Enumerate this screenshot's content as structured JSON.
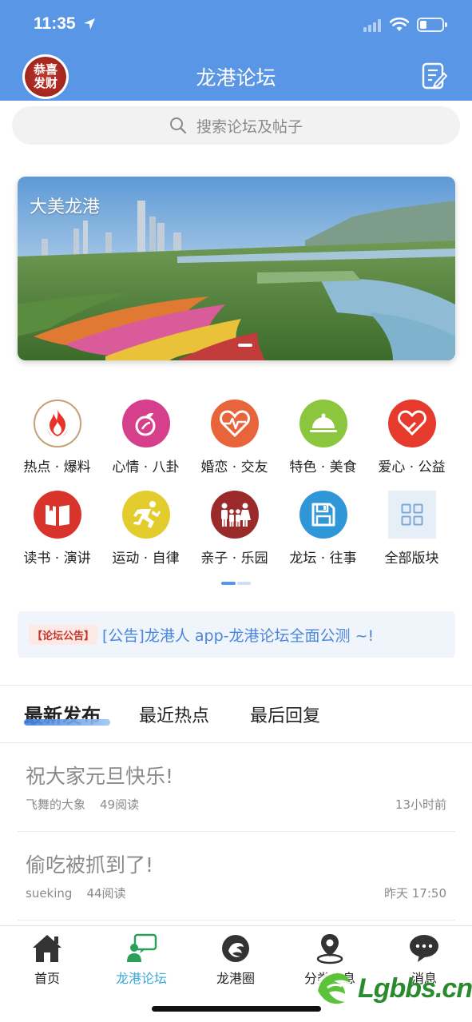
{
  "status_bar": {
    "time": "11:35"
  },
  "header": {
    "avatar_text_line1": "恭喜",
    "avatar_text_line2": "发财",
    "title": "龙港论坛"
  },
  "search": {
    "placeholder": "搜索论坛及帖子"
  },
  "banner": {
    "caption": "大美龙港"
  },
  "categories": [
    {
      "label": "热点 · 爆料",
      "icon": "flame-icon",
      "color": "#ffffff"
    },
    {
      "label": "心情 · 八卦",
      "icon": "fruit-icon",
      "color": "#d63f8c"
    },
    {
      "label": "婚恋 · 交友",
      "icon": "heartbeat-icon",
      "color": "#e8643a"
    },
    {
      "label": "特色 · 美食",
      "icon": "dish-cover-icon",
      "color": "#8cc63f"
    },
    {
      "label": "爱心 · 公益",
      "icon": "hand-heart-icon",
      "color": "#e53a2c"
    },
    {
      "label": "读书 · 演讲",
      "icon": "book-icon",
      "color": "#d9342b"
    },
    {
      "label": "运动 · 自律",
      "icon": "runner-icon",
      "color": "#e3cd2e"
    },
    {
      "label": "亲子 · 乐园",
      "icon": "family-icon",
      "color": "#9b2b2b"
    },
    {
      "label": "龙坛 · 往事",
      "icon": "save-disk-icon",
      "color": "#2f97d8"
    },
    {
      "label": "全部版块",
      "icon": "grid-icon",
      "color": "#e6eef7"
    }
  ],
  "notice": {
    "tag": "【论坛公告】",
    "text": "[公告]龙港人 app-龙港论坛全面公测 ~!"
  },
  "tabs": [
    {
      "label": "最新发布",
      "active": true
    },
    {
      "label": "最近热点",
      "active": false
    },
    {
      "label": "最后回复",
      "active": false
    }
  ],
  "posts": [
    {
      "title": "祝大家元旦快乐!",
      "author": "飞舞的大象",
      "reads": "49阅读",
      "time": "13小时前"
    },
    {
      "title": "偷吃被抓到了!",
      "author": "sueking",
      "reads": "44阅读",
      "time": "昨天 17:50"
    }
  ],
  "bottom_nav": [
    {
      "label": "首页",
      "icon": "home-icon",
      "active": false
    },
    {
      "label": "龙港论坛",
      "icon": "forum-chat-icon",
      "active": true
    },
    {
      "label": "龙港圈",
      "icon": "dragon-circle-icon",
      "active": false
    },
    {
      "label": "分类信息",
      "icon": "location-pin-icon",
      "active": false
    },
    {
      "label": "消息",
      "icon": "message-bubble-icon",
      "active": false
    }
  ],
  "watermark": {
    "text": "Lgbbs.cn"
  },
  "colors": {
    "primary": "#5a96e6",
    "active_nav": "#3aa8d8",
    "notice_text": "#4a86dd",
    "notice_tag": "#c4382c"
  }
}
